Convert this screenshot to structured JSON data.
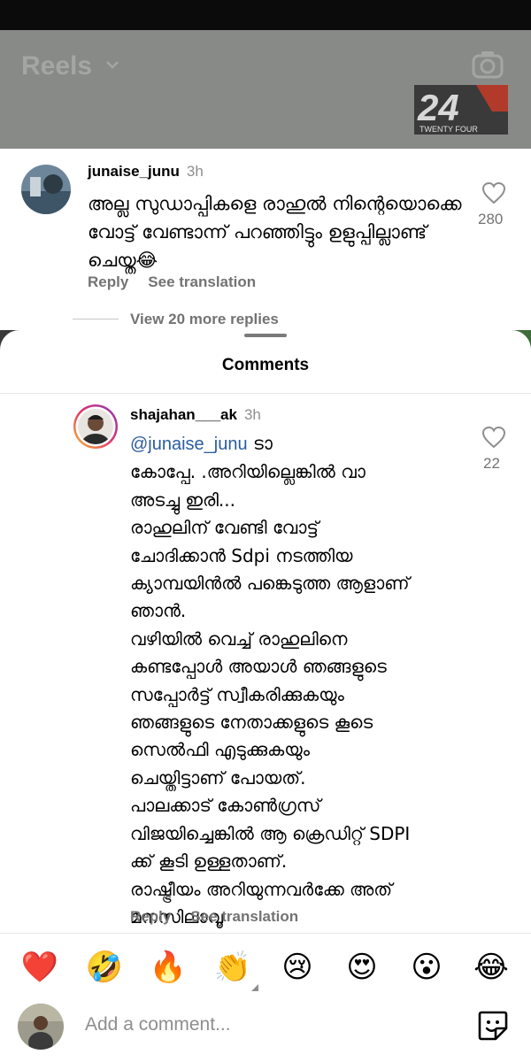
{
  "reels_header": {
    "title": "Reels",
    "logo_text_top": "24",
    "logo_text_bottom": "TWENTY FOUR"
  },
  "comment_top": {
    "username": "junaise_junu",
    "time": "3h",
    "text": "അല്ല സുഡാപ്പികളെ രാഹുൽ നിന്റെയൊക്കെ വോട്ട് വേണ്ടാന്ന് പറഞ്ഞിട്ടും ഉളുപ്പില്ലാണ്ട് ചെയ്ത😂",
    "like_count": "280",
    "reply_label": "Reply",
    "see_translation_label": "See translation",
    "view_more_replies": "View 20 more replies"
  },
  "sheet": {
    "title": "Comments"
  },
  "reply": {
    "username": "shajahan___ak",
    "time": "3h",
    "mention": "@junaise_junu",
    "text": " ടാ\nകോപ്പേ. .അറിയില്ലെങ്കിൽ വാ\nഅടച്ചു ഇരി...\nരാഹുലിന് വേണ്ടി വോട്ട്\nചോദിക്കാൻ Sdpi നടത്തിയ\nക്യാമ്പയിൻൽ പങ്കെടുത്ത ആളാണ്\nഞാൻ.\nവഴിയിൽ വെച്ച് രാഹുലിനെ\nകണ്ടപ്പോൾ അയാൾ ഞങ്ങളുടെ\nസപ്പോർട്ട് സ്വീകരിക്കുകയും\nഞങ്ങളുടെ നേതാക്കളുടെ കൂടെ\nസെൽഫി എടുക്കുകയും\nചെയ്തിട്ടാണ് പോയത്.\nപാലക്കാട് കോൺഗ്രസ്\nവിജയിച്ചെങ്കിൽ ആ ക്രെഡിറ്റ് SDPI\nക്ക് കൂടി ഉള്ളതാണ്.\nരാഷ്ട്രീയം അറിയുന്നവർക്കേ അത്\nമനസിലാവൂ",
    "like_count": "22",
    "reply_label": "Reply",
    "see_translation_label": "See translation"
  },
  "reactions": [
    "❤️",
    "🤣",
    "🔥",
    "👏",
    "😢",
    "😍",
    "😮",
    "😂"
  ],
  "composer": {
    "placeholder": "Add a comment..."
  },
  "colors": {
    "mention": "#2b5c9e",
    "muted": "#737373",
    "reel_dim": "#888a88"
  }
}
